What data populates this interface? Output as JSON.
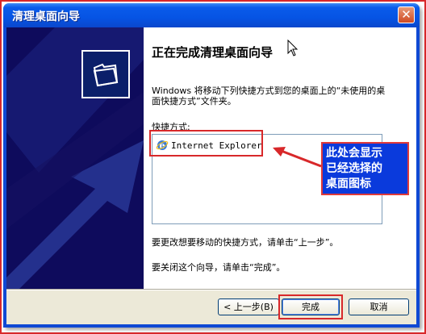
{
  "window": {
    "title": "清理桌面向导",
    "close_label": "✕"
  },
  "content": {
    "heading": "正在完成清理桌面向导",
    "description": "Windows 将移动下列快捷方式到您的桌面上的“未使用的桌面快捷方式”文件夹。",
    "shortcuts_label": "快捷方式:",
    "shortcuts": [
      {
        "name": "Internet Explorer",
        "icon": "internet-explorer-icon"
      }
    ],
    "note_back": "要更改想要移动的快捷方式，请单击“上一步”。",
    "note_finish": "要关闭这个向导，请单击“完成”。"
  },
  "annotation": {
    "line1": "此处会显示",
    "line2": "已经选择的",
    "line3": "桌面图标"
  },
  "buttons": {
    "back": "< 上一步(B)",
    "finish": "完成",
    "cancel": "取消"
  },
  "colors": {
    "titlebar": "#0654e4",
    "side_panel": "#0e0b5c",
    "highlight": "#d8282a",
    "callout": "#0a3adc"
  }
}
